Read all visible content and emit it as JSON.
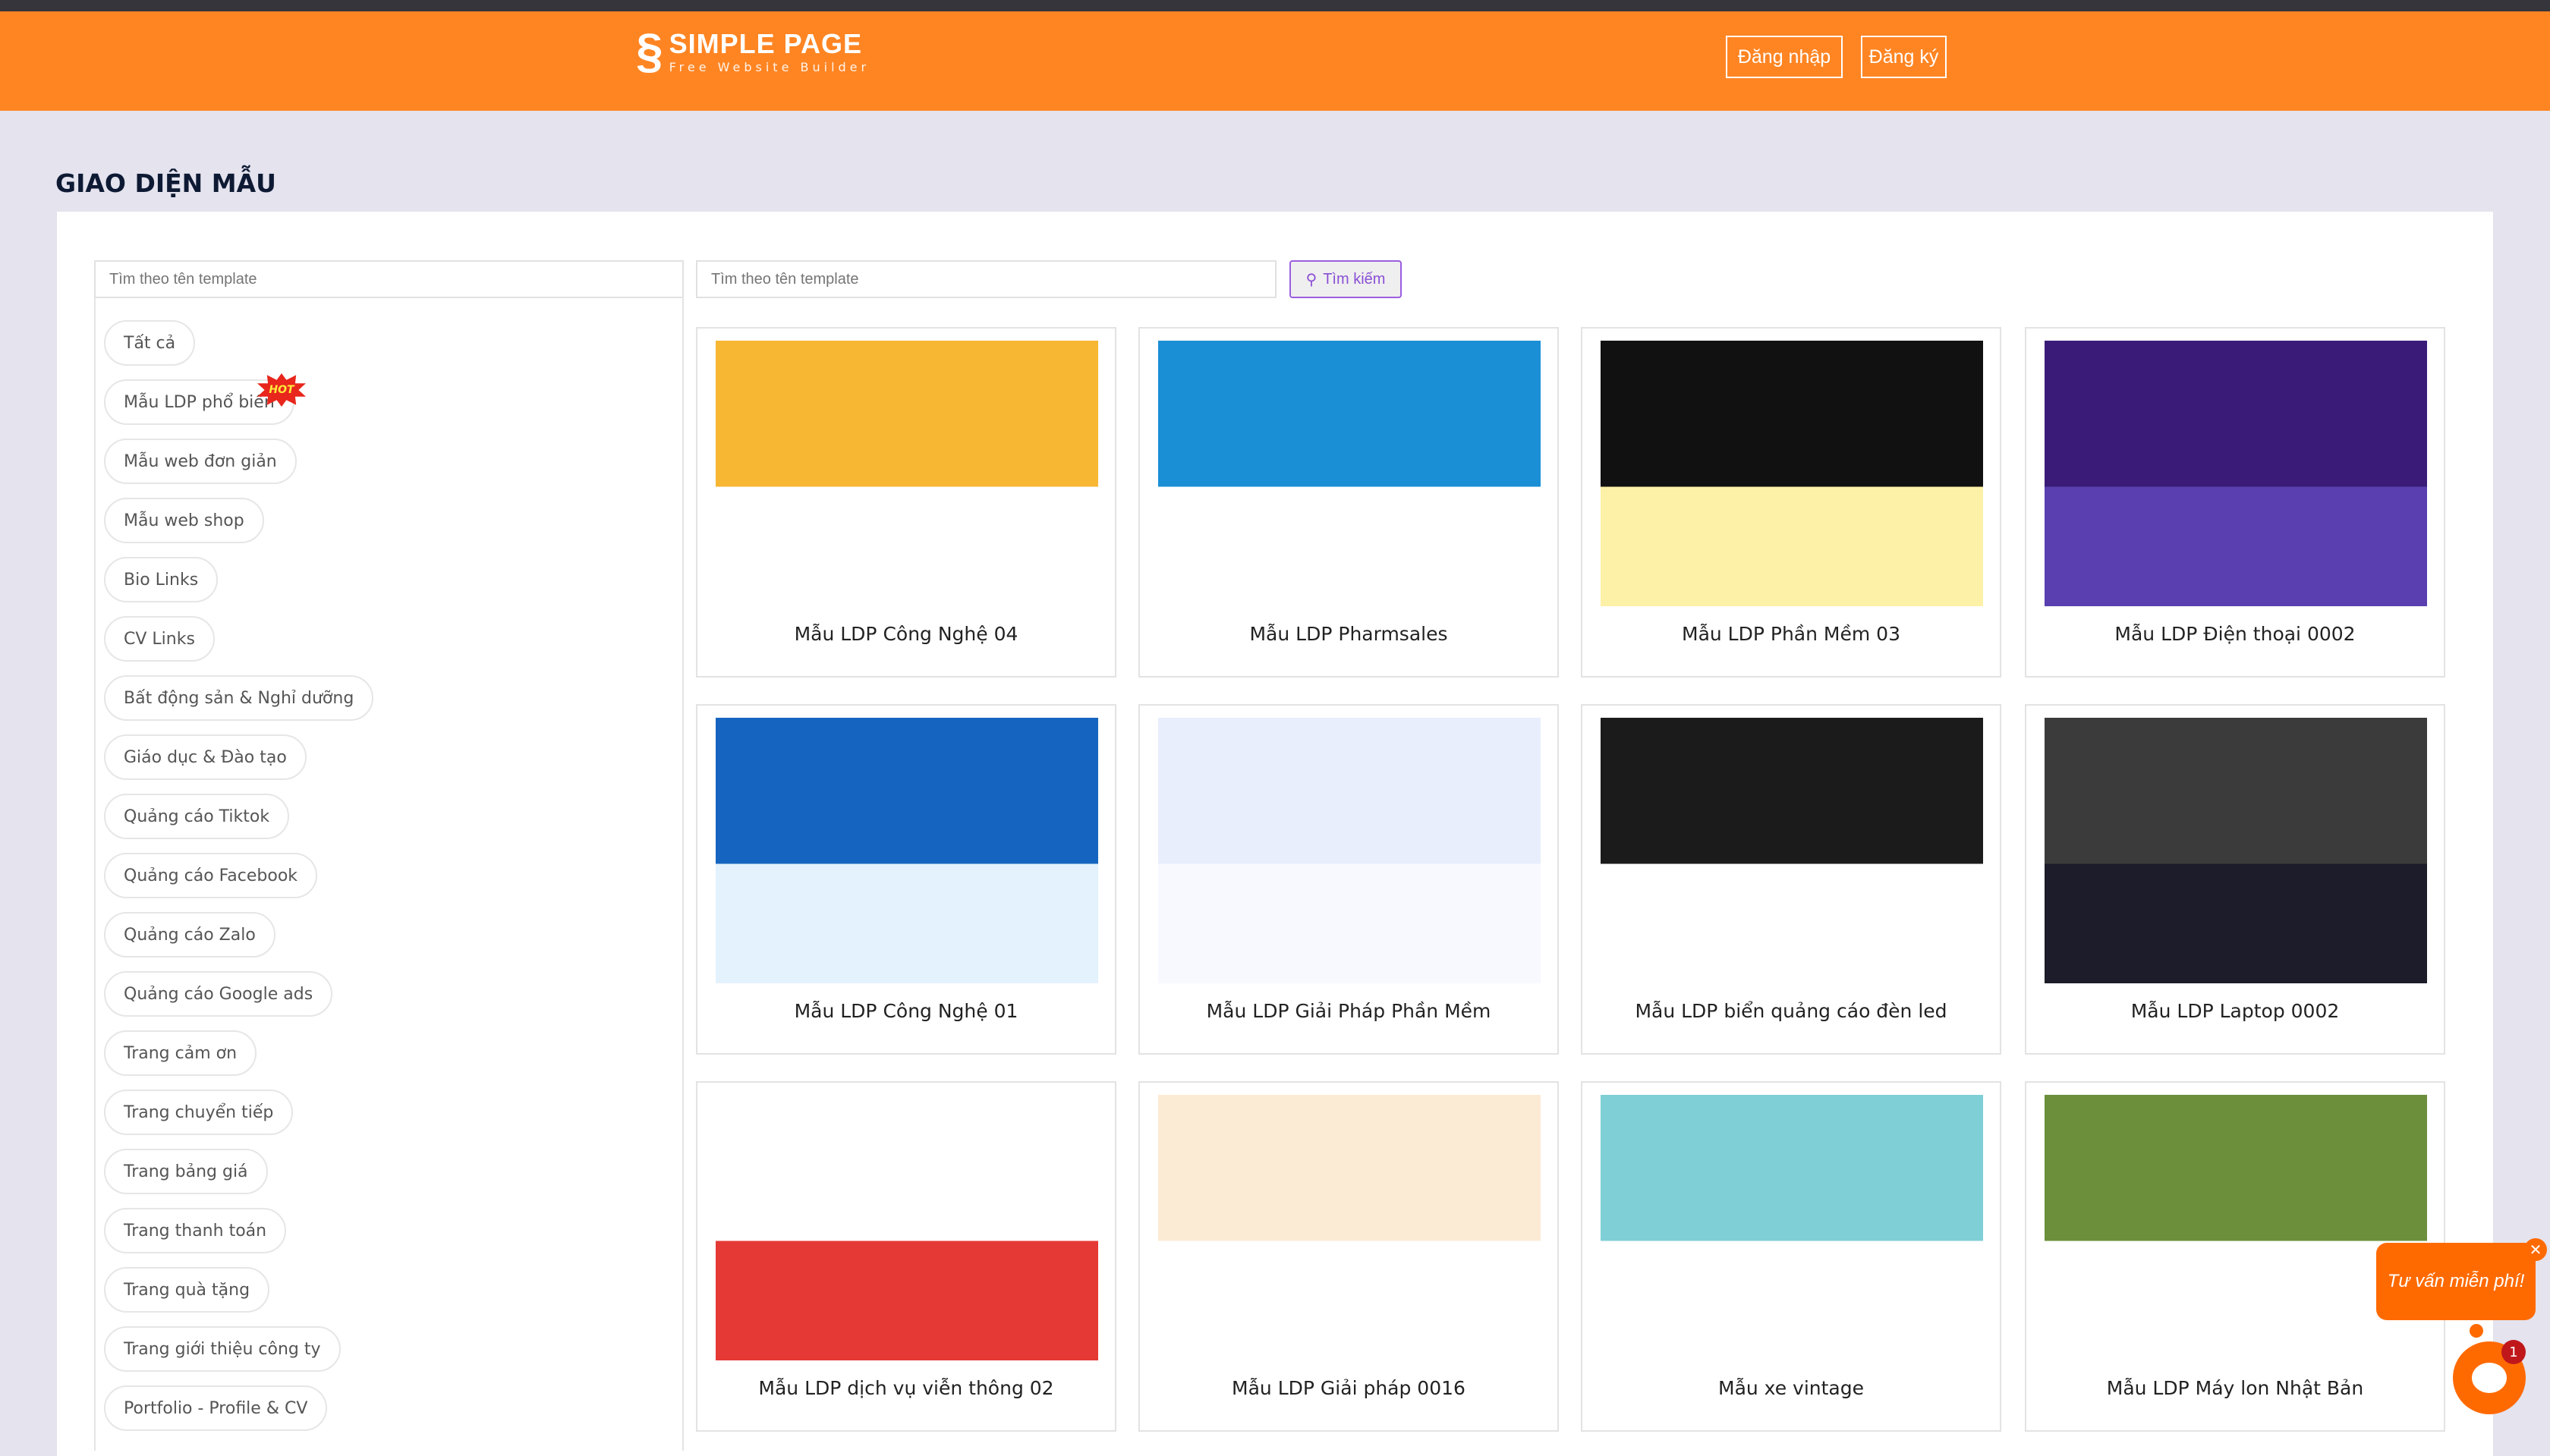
{
  "header": {
    "brand": "SIMPLE PAGE",
    "tagline": "Free Website Builder",
    "login": "Đăng nhập",
    "register": "Đăng ký",
    "color": "#ff8523"
  },
  "page_title": "GIAO DIỆN MẪU",
  "sidebar": {
    "search_placeholder": "Tìm theo tên template",
    "hot_badge": "HOT",
    "items": [
      "Tất cả",
      "Mẫu LDP phổ biến",
      "Mẫu web đơn giản",
      "Mẫu web shop",
      "Bio Links",
      "CV Links",
      "Bất động sản & Nghỉ dưỡng",
      "Giáo dục & Đào tạo",
      "Quảng cáo Tiktok",
      "Quảng cáo Facebook",
      "Quảng cáo Zalo",
      "Quảng cáo Google ads",
      "Trang cảm ơn",
      "Trang chuyển tiếp",
      "Trang bảng giá",
      "Trang thanh toán",
      "Trang quà tặng",
      "Trang giới thiệu công ty",
      "Portfolio - Profile & CV"
    ]
  },
  "search": {
    "placeholder": "Tìm theo tên template",
    "button": "Tìm kiếm",
    "accent": "#9c5ee0"
  },
  "templates": [
    {
      "name": "Mẫu LDP Công Nghệ 04",
      "colors": [
        "#f7b733",
        "#ffffff"
      ]
    },
    {
      "name": "Mẫu LDP Pharmsales",
      "colors": [
        "#1a8fd6",
        "#ffffff"
      ]
    },
    {
      "name": "Mẫu LDP Phần Mềm 03",
      "colors": [
        "#111111",
        "#fdf1a8"
      ]
    },
    {
      "name": "Mẫu LDP Điện thoại 0002",
      "colors": [
        "#3a1c78",
        "#5a3fb0"
      ]
    },
    {
      "name": "Mẫu LDP Công Nghệ 01",
      "colors": [
        "#1565c0",
        "#e3f2fd"
      ]
    },
    {
      "name": "Mẫu LDP Giải Pháp Phần Mềm",
      "colors": [
        "#e8eefc",
        "#f7f9ff"
      ]
    },
    {
      "name": "Mẫu LDP biển quảng cáo đèn led",
      "colors": [
        "#1b1b1b",
        "#ffffff"
      ]
    },
    {
      "name": "Mẫu LDP Laptop 0002",
      "colors": [
        "#3b3b3b",
        "#1c1c2a"
      ]
    },
    {
      "name": "Mẫu LDP dịch vụ viễn thông 02",
      "colors": [
        "#ffffff",
        "#e53935"
      ]
    },
    {
      "name": "Mẫu LDP Giải pháp 0016",
      "colors": [
        "#fcebd4",
        "#ffffff"
      ]
    },
    {
      "name": "Mẫu xe vintage",
      "colors": [
        "#7fcfd6",
        "#ffffff"
      ]
    },
    {
      "name": "Mẫu LDP Máy lon Nhật Bản",
      "colors": [
        "#6b8f3a",
        "#ffffff"
      ]
    }
  ],
  "chat": {
    "bubble": "Tư vấn miễn phí!",
    "badge": "1",
    "color": "#ff6a00"
  }
}
